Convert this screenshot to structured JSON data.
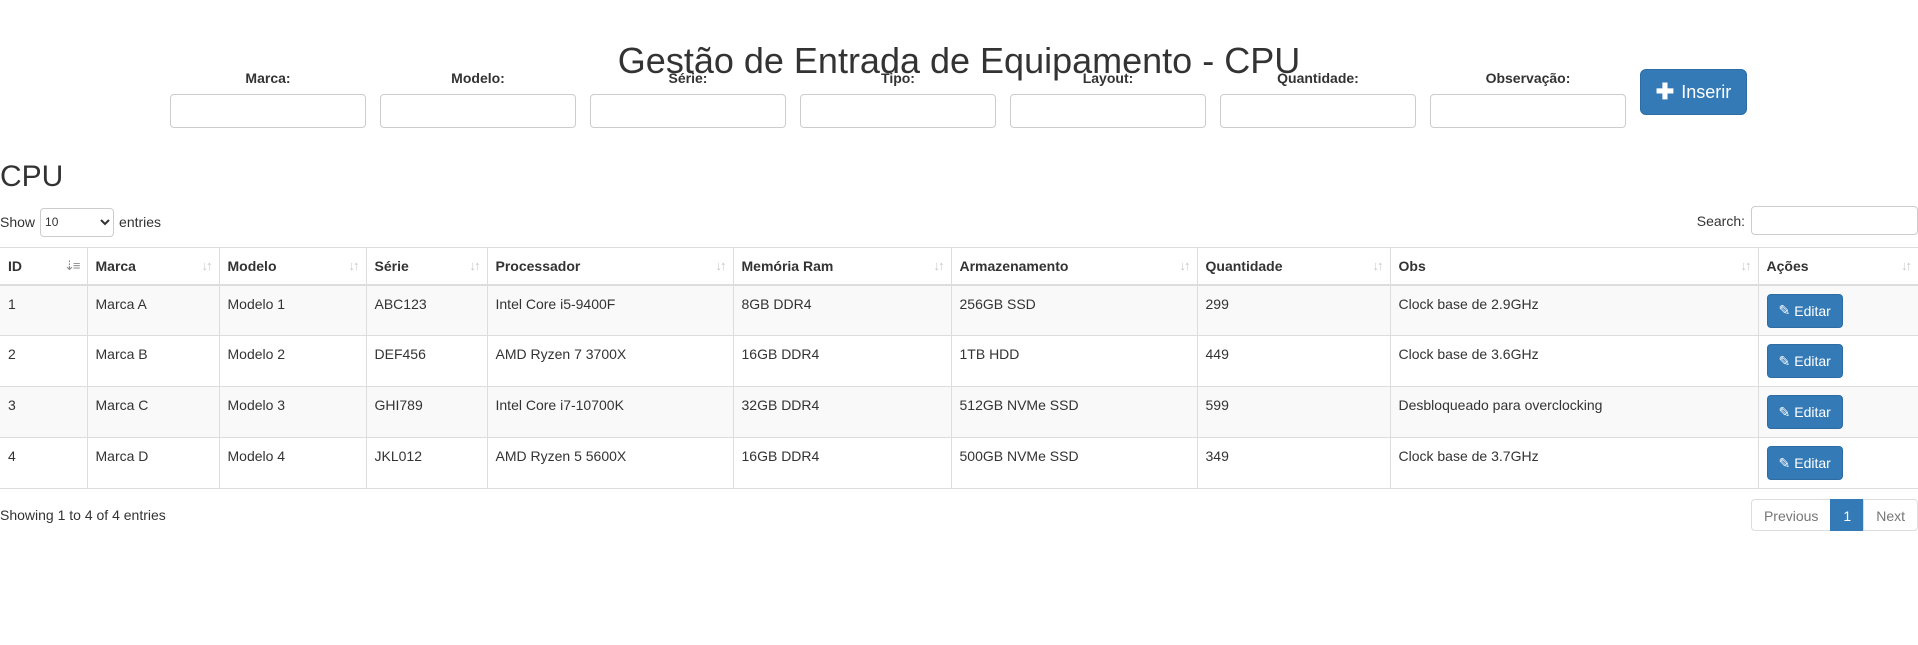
{
  "page": {
    "title": "Gestão de Entrada de Equipamento - CPU"
  },
  "form": {
    "fields": [
      {
        "label": "Marca:",
        "value": ""
      },
      {
        "label": "Modelo:",
        "value": ""
      },
      {
        "label": "Série:",
        "value": ""
      },
      {
        "label": "Tipo:",
        "value": ""
      },
      {
        "label": "Layout:",
        "value": ""
      },
      {
        "label": "Quantidade:",
        "value": ""
      },
      {
        "label": "Observação:",
        "value": ""
      }
    ],
    "insert_button": {
      "label": "Inserir",
      "icon": "plus-icon"
    }
  },
  "table_section": {
    "title": "CPU",
    "length": {
      "show_label": "Show",
      "selected": "10",
      "entries_label": "entries"
    },
    "search": {
      "label": "Search:",
      "value": ""
    },
    "columns": [
      "ID",
      "Marca",
      "Modelo",
      "Série",
      "Processador",
      "Memória Ram",
      "Armazenamento",
      "Quantidade",
      "Obs",
      "Ações"
    ],
    "sorted_column": "ID",
    "rows": [
      {
        "id": "1",
        "marca": "Marca A",
        "modelo": "Modelo 1",
        "serie": "ABC123",
        "processador": "Intel Core i5-9400F",
        "memoria": "8GB DDR4",
        "armazenamento": "256GB SSD",
        "quantidade": "299",
        "obs": "Clock base de 2.9GHz",
        "action": "Editar"
      },
      {
        "id": "2",
        "marca": "Marca B",
        "modelo": "Modelo 2",
        "serie": "DEF456",
        "processador": "AMD Ryzen 7 3700X",
        "memoria": "16GB DDR4",
        "armazenamento": "1TB HDD",
        "quantidade": "449",
        "obs": "Clock base de 3.6GHz",
        "action": "Editar"
      },
      {
        "id": "3",
        "marca": "Marca C",
        "modelo": "Modelo 3",
        "serie": "GHI789",
        "processador": "Intel Core i7-10700K",
        "memoria": "32GB DDR4",
        "armazenamento": "512GB NVMe SSD",
        "quantidade": "599",
        "obs": "Desbloqueado para overclocking",
        "action": "Editar"
      },
      {
        "id": "4",
        "marca": "Marca D",
        "modelo": "Modelo 4",
        "serie": "JKL012",
        "processador": "AMD Ryzen 5 5600X",
        "memoria": "16GB DDR4",
        "armazenamento": "500GB NVMe SSD",
        "quantidade": "349",
        "obs": "Clock base de 3.7GHz",
        "action": "Editar"
      }
    ],
    "info": "Showing 1 to 4 of 4 entries",
    "pagination": {
      "previous": "Previous",
      "current_page": "1",
      "next": "Next"
    }
  },
  "colors": {
    "primary": "#337ab7",
    "primary_border": "#2e6da4",
    "row_stripe": "#f9f9f9",
    "border": "#dddddd"
  }
}
